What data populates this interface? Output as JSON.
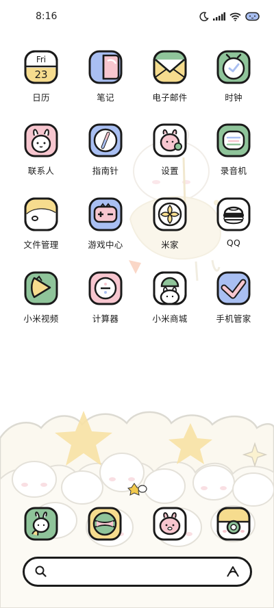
{
  "status_bar": {
    "time": "8:16",
    "icons": [
      "moon-icon",
      "signal-icon",
      "wifi-icon",
      "battery-icon"
    ]
  },
  "apps": [
    {
      "label": "日历",
      "icon": "calendar-icon",
      "day_abbr": "Fri",
      "day_number": "23"
    },
    {
      "label": "笔记",
      "icon": "notes-icon"
    },
    {
      "label": "电子邮件",
      "icon": "email-icon"
    },
    {
      "label": "时钟",
      "icon": "clock-icon"
    },
    {
      "label": "联系人",
      "icon": "contacts-icon"
    },
    {
      "label": "指南针",
      "icon": "compass-icon"
    },
    {
      "label": "设置",
      "icon": "settings-icon"
    },
    {
      "label": "录音机",
      "icon": "recorder-icon"
    },
    {
      "label": "文件管理",
      "icon": "file-manager-icon"
    },
    {
      "label": "游戏中心",
      "icon": "game-center-icon"
    },
    {
      "label": "米家",
      "icon": "mijia-icon"
    },
    {
      "label": "QQ",
      "icon": "qq-icon"
    },
    {
      "label": "小米视频",
      "icon": "video-icon"
    },
    {
      "label": "计算器",
      "icon": "calculator-icon"
    },
    {
      "label": "小米商城",
      "icon": "mi-store-icon"
    },
    {
      "label": "手机管家",
      "icon": "security-icon"
    }
  ],
  "dock": [
    {
      "icon": "phone-icon"
    },
    {
      "icon": "browser-icon"
    },
    {
      "icon": "messages-icon"
    },
    {
      "icon": "camera-icon"
    }
  ],
  "search": {
    "placeholder": ""
  },
  "colors": {
    "outline": "#1a1a1a",
    "pink": "#f7c6cf",
    "green": "#8fc49a",
    "blue": "#a9bff2",
    "yellow": "#f6dc8e",
    "cream": "#fdf6e6"
  }
}
